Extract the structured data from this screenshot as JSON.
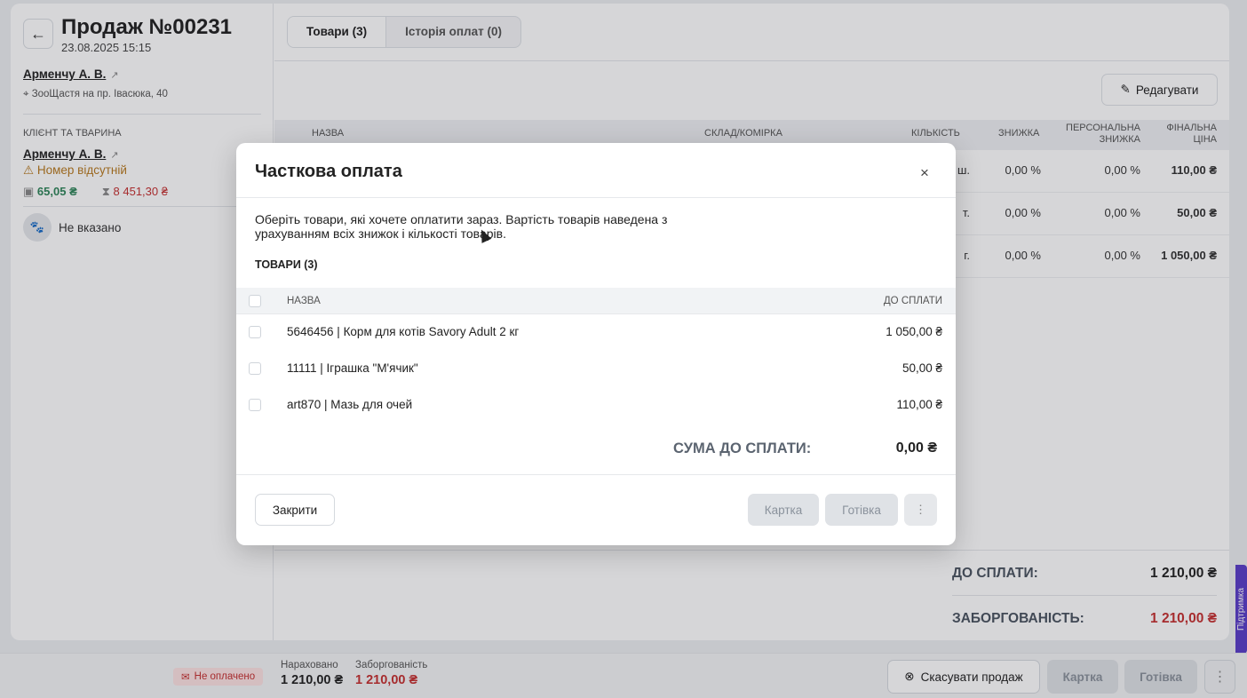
{
  "sale": {
    "back_icon": "arrow-left-icon",
    "title": "Продаж №00231",
    "date": "23.08.2025 15:15",
    "employee": "Арменчу А. В.",
    "address": "ЗооЩастя на пр. Івасюка, 40",
    "client_section_label": "Клієнт та тварина",
    "client": "Арменчу А. В.",
    "phone_warning": "Номер відсутній",
    "balance": "65,05 ₴",
    "debt": "8 451,30 ₴",
    "pet": "Не вказано"
  },
  "tabs": [
    "Товари (3)",
    "Історія оплат (0)"
  ],
  "edit_label": "Редагувати",
  "table": {
    "headers": {
      "name": "Назва",
      "warehouse": "Склад/комірка",
      "qty": "Кількість",
      "discount": "Знижка",
      "personal_discount_1": "Персональна",
      "personal_discount_2": "знижка",
      "final_price_1": "Фінальна",
      "final_price_2": "ціна"
    },
    "rows": [
      {
        "qty": "ш.",
        "discount": "0,00 %",
        "personal": "0,00 %",
        "final": "110,00 ₴"
      },
      {
        "qty": "т.",
        "discount": "0,00 %",
        "personal": "0,00 %",
        "final": "50,00 ₴"
      },
      {
        "qty": "г.",
        "discount": "0,00 %",
        "personal": "0,00 %",
        "final": "1 050,00 ₴"
      }
    ]
  },
  "totals": {
    "to_pay_label": "До сплати:",
    "to_pay_value": "1 210,00 ₴",
    "debt_label": "Заборгованість:",
    "debt_value": "1 210,00 ₴"
  },
  "support_label": "Підтримка",
  "footer": {
    "status": "Не оплачено",
    "accrued_label": "Нараховано",
    "accrued_value": "1 210,00 ₴",
    "debt_label": "Заборгованість",
    "debt_value": "1 210,00 ₴",
    "cancel_label": "Скасувати продаж",
    "card_label": "Картка",
    "cash_label": "Готівка",
    "more_label": "⋮"
  },
  "modal": {
    "title": "Часткова оплата",
    "close_label": "×",
    "description": "Оберіть товари, які хочете оплатити зараз. Вартість товарів наведена з урахуванням всіх знижок і кількості товарів.",
    "subtitle": "Товари (3)",
    "col_name": "Назва",
    "col_to_pay": "До сплати",
    "items": [
      {
        "name": "5646456 | Корм для котів Savory Adult 2 кг",
        "value": "1 050,00 ₴"
      },
      {
        "name": "11111 | Іграшка \"М'ячик\"",
        "value": "50,00 ₴"
      },
      {
        "name": "art870 | Мазь для очей",
        "value": "110,00 ₴"
      }
    ],
    "sum_label": "Сума до сплати:",
    "sum_value": "0,00 ₴",
    "close_button": "Закрити",
    "card_button": "Картка",
    "cash_button": "Готівка",
    "more_button": "⋮"
  },
  "colors": {
    "danger": "#c53030",
    "success": "#2f855a",
    "warning": "#b7791f",
    "support": "#5a3ec8"
  }
}
